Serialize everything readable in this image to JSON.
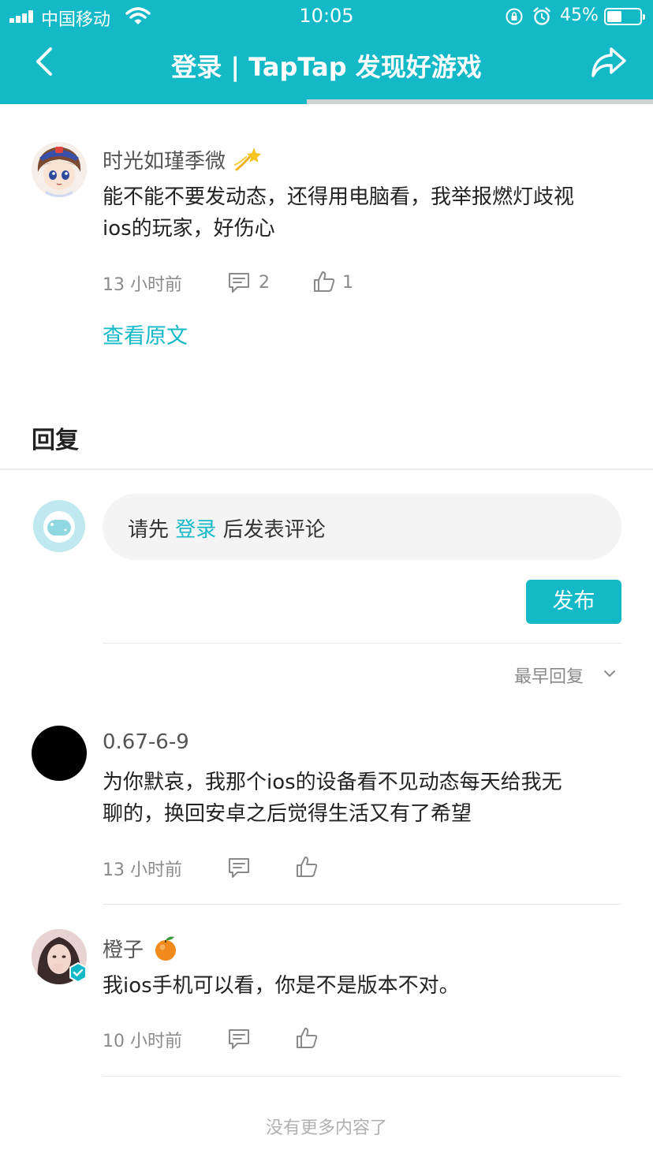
{
  "status_bar": {
    "carrier": "中国移动",
    "time": "10:05",
    "battery_percent": "45%",
    "battery_level": 0.45
  },
  "header": {
    "title": "登录 | TapTap 发现好游戏",
    "page_load_progress": 0.47,
    "accent_color": "#14b9c8"
  },
  "post": {
    "author": "时光如瑾季微",
    "content_line1": "能不能不要发动态，还得用电脑看，我举报燃灯歧视",
    "content_line2": "ios的玩家，好伤心",
    "time": "13 小时前",
    "comment_count": "2",
    "like_count": "1",
    "view_original": "查看原文"
  },
  "replies_section": {
    "heading": "回复",
    "input_prefix": "请先",
    "input_login": "登录",
    "input_suffix": "后发表评论",
    "publish": "发布",
    "sort_label": "最早回复"
  },
  "replies": [
    {
      "author": "0.67-6-9",
      "line1": "为你默哀，我那个ios的设备看不见动态每天给我无",
      "line2": "聊的，换回安卓之后觉得生活又有了希望",
      "time": "13 小时前"
    },
    {
      "author": "橙子",
      "line1": "我ios手机可以看，你是不是版本不对。",
      "time": "10 小时前",
      "verified": true
    }
  ],
  "footer": {
    "no_more": "没有更多内容了"
  }
}
